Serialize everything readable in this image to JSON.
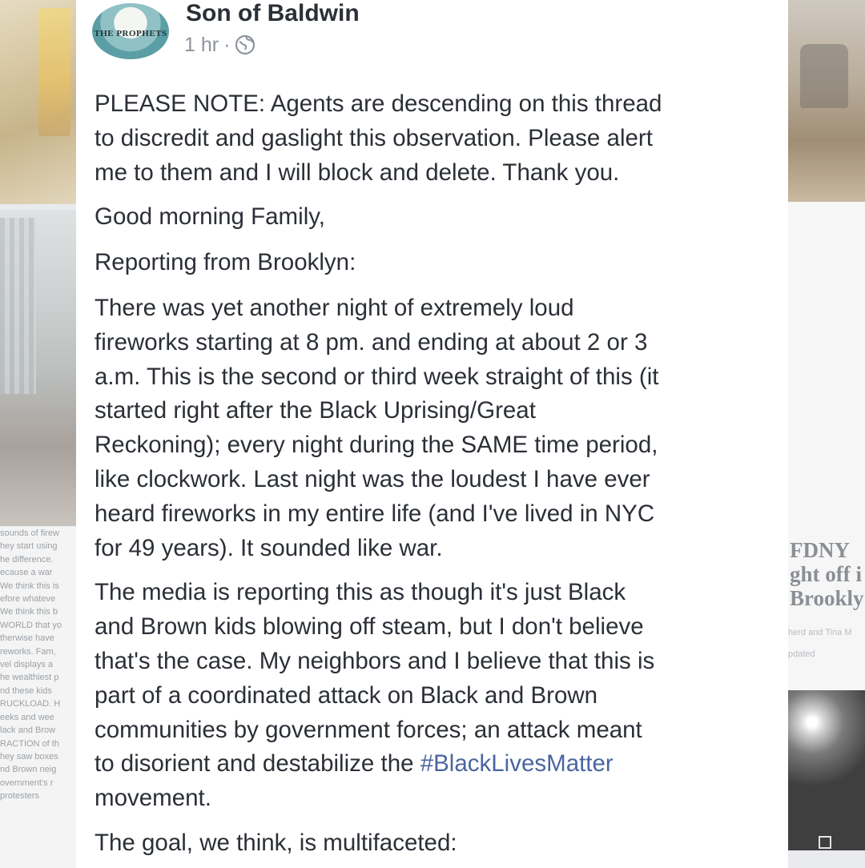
{
  "post": {
    "author": "Son of Baldwin",
    "avatar_text": "THE PROPHETS",
    "time": "1 hr",
    "separator": "·",
    "privacy_icon": "globe-icon",
    "paragraphs": [
      [
        "PLEASE NOTE: Agents are descending on this thread",
        "to discredit and gaslight this observation. Please alert",
        "me to them and I will block and delete. Thank you."
      ],
      [
        "Good morning Family,"
      ],
      [
        "Reporting from Brooklyn:"
      ],
      [
        "There was yet another night of extremely loud",
        "fireworks starting at 8 pm. and ending at about 2 or 3",
        "a.m. This is the second or third week straight of this (it",
        "started right after the Black Uprising/Great",
        "Reckoning); every night during the SAME time period,",
        "like clockwork. Last night was the loudest I have ever",
        "heard fireworks in my entire life (and I've lived in NYC",
        "for 49 years). It sounded like war."
      ],
      [
        "The media is reporting this as though it's just Black",
        "and Brown kids blowing off steam, but I don't believe",
        "that's the case. My neighbors and I believe that this is",
        "part of a coordinated attack on Black and Brown",
        "communities by government forces; an attack meant"
      ],
      [
        "The goal, we think, is multifaceted:"
      ]
    ],
    "disorient_prefix": "to disorient and destabilize the ",
    "hashtag": "#BlackLivesMatter",
    "movement_line": "movement."
  },
  "background": {
    "left_snippets": [
      "sounds of firew",
      "hey start using",
      "he difference.",
      "ecause a war",
      "We think this is",
      "efore whateve",
      "We think this b",
      "WORLD that yo",
      "therwise have",
      "reworks. Fam,",
      "vel displays a",
      "he wealthiest p",
      "nd these kids",
      "RUCKLOAD. H",
      "eeks and wee",
      "lack and Brow",
      "RACTION of th",
      "hey saw boxes",
      "nd Brown neig",
      "overnment's r",
      "protesters"
    ],
    "right_title_lines": [
      "FDNY",
      "ght off i",
      "Brookly"
    ],
    "right_meta_lines": [
      "herd and Tina M",
      "pdated"
    ]
  },
  "colors": {
    "text": "#2b2f36",
    "meta": "#8d949e",
    "hashtag": "#4a65a1",
    "card": "#ffffff"
  }
}
